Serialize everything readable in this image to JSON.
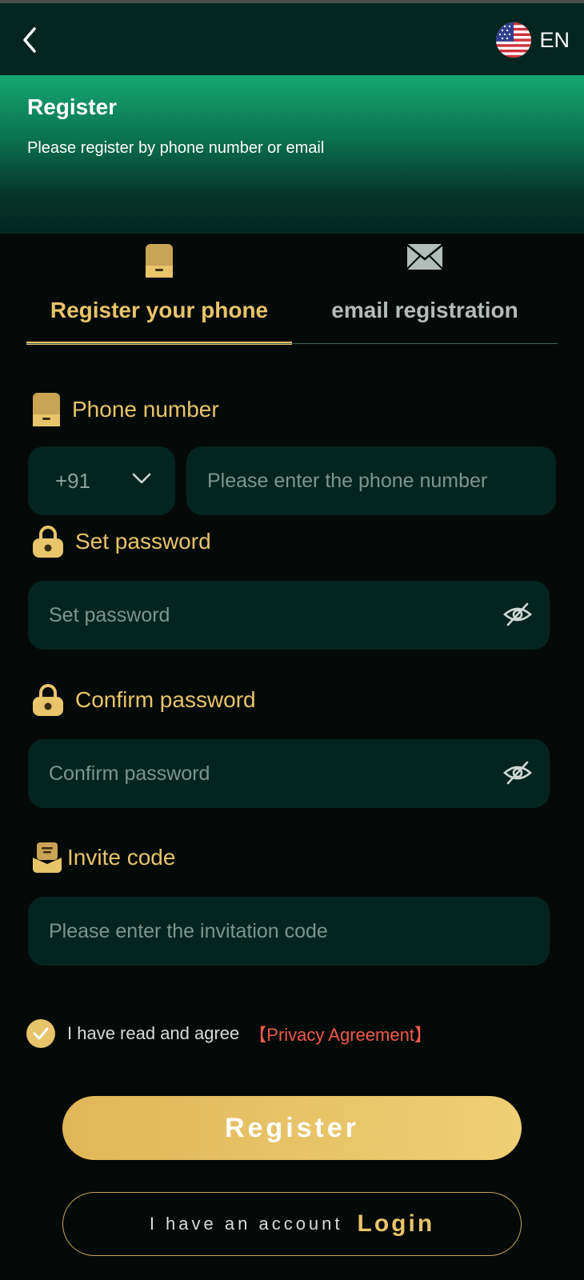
{
  "header": {
    "back_icon": "chevron-left-icon",
    "language_flag_icon": "us-flag-icon",
    "language_code": "EN"
  },
  "hero": {
    "title": "Register",
    "subtitle": "Please register by phone number or email"
  },
  "tabs": [
    {
      "label": "Register your phone",
      "icon": "phone-icon",
      "active": true
    },
    {
      "label": "email registration",
      "icon": "envelope-icon",
      "active": false
    }
  ],
  "form": {
    "phone": {
      "label": "Phone number",
      "country_code": "+91",
      "placeholder": "Please enter the phone number"
    },
    "password": {
      "label": "Set password",
      "placeholder": "Set password"
    },
    "confirm": {
      "label": "Confirm password",
      "placeholder": "Confirm password"
    },
    "invite": {
      "label": "Invite code",
      "placeholder": "Please enter the invitation code"
    }
  },
  "agreement": {
    "checked": true,
    "text": "I have read and agree",
    "link": "【Privacy Agreement】"
  },
  "actions": {
    "register_label": "Register",
    "login_prefix": "I have an account",
    "login_label": "Login"
  },
  "colors": {
    "accent_gold": "#e8c46a",
    "input_bg": "#04251f",
    "link_red": "#f0584c",
    "hero_green": "#16a673"
  }
}
